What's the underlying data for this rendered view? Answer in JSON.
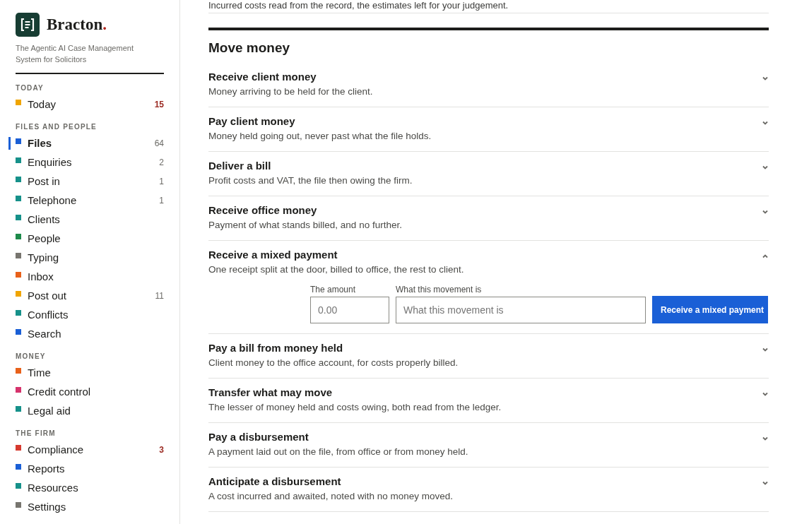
{
  "brand": {
    "name": "Bracton",
    "mark": ".",
    "tagline": "The Agentic AI Case Management System for Solicitors"
  },
  "sidebar": {
    "sections": [
      {
        "heading": "TODAY",
        "items": [
          {
            "label": "Today",
            "color": "#f0a500",
            "count": "15",
            "urgent": true,
            "selected": false
          }
        ]
      },
      {
        "heading": "FILES AND PEOPLE",
        "items": [
          {
            "label": "Files",
            "color": "#1a5fd6",
            "count": "64",
            "urgent": false,
            "selected": true
          },
          {
            "label": "Enquiries",
            "color": "#16918a",
            "count": "2",
            "urgent": false,
            "selected": false
          },
          {
            "label": "Post in",
            "color": "#16918a",
            "count": "1",
            "urgent": false,
            "selected": false
          },
          {
            "label": "Telephone",
            "color": "#16918a",
            "count": "1",
            "urgent": false,
            "selected": false
          },
          {
            "label": "Clients",
            "color": "#16918a",
            "selected": false
          },
          {
            "label": "People",
            "color": "#1d8a4a",
            "selected": false
          },
          {
            "label": "Typing",
            "color": "#77756f",
            "selected": false
          },
          {
            "label": "Inbox",
            "color": "#e8611a",
            "selected": false
          },
          {
            "label": "Post out",
            "color": "#f0a500",
            "count": "11",
            "urgent": false,
            "selected": false
          },
          {
            "label": "Conflicts",
            "color": "#16918a",
            "selected": false
          },
          {
            "label": "Search",
            "color": "#1a5fd6",
            "selected": false
          }
        ]
      },
      {
        "heading": "MONEY",
        "items": [
          {
            "label": "Time",
            "color": "#e8611a",
            "selected": false
          },
          {
            "label": "Credit control",
            "color": "#d6336c",
            "selected": false
          },
          {
            "label": "Legal aid",
            "color": "#16918a",
            "selected": false
          }
        ]
      },
      {
        "heading": "THE FIRM",
        "items": [
          {
            "label": "Compliance",
            "color": "#d63a2f",
            "count": "3",
            "urgent": true,
            "selected": false
          },
          {
            "label": "Reports",
            "color": "#1a5fd6",
            "selected": false
          },
          {
            "label": "Resources",
            "color": "#16918a",
            "selected": false
          },
          {
            "label": "Settings",
            "color": "#77756f",
            "selected": false
          }
        ]
      }
    ]
  },
  "main": {
    "intro": "Incurred costs read from the record, the estimates left for your judgement.",
    "heading": "Move money",
    "actions": [
      {
        "title": "Receive client money",
        "description": "Money arriving to be held for the client.",
        "expanded": false
      },
      {
        "title": "Pay client money",
        "description": "Money held going out, never past what the file holds.",
        "expanded": false
      },
      {
        "title": "Deliver a bill",
        "description": "Profit costs and VAT, the file then owing the firm.",
        "expanded": false
      },
      {
        "title": "Receive office money",
        "description": "Payment of what stands billed, and no further.",
        "expanded": false
      },
      {
        "title": "Receive a mixed payment",
        "description": "One receipt split at the door, billed to office, the rest to client.",
        "expanded": true,
        "form": {
          "amount_label": "The amount",
          "amount_placeholder": "0.00",
          "what_label": "What this movement is",
          "what_placeholder": "What this movement is",
          "submit": "Receive a mixed payment"
        }
      },
      {
        "title": "Pay a bill from money held",
        "description": "Client money to the office account, for costs properly billed.",
        "expanded": false
      },
      {
        "title": "Transfer what may move",
        "description": "The lesser of money held and costs owing, both read from the ledger.",
        "expanded": false
      },
      {
        "title": "Pay a disbursement",
        "description": "A payment laid out on the file, from office or from money held.",
        "expanded": false
      },
      {
        "title": "Anticipate a disbursement",
        "description": "A cost incurred and awaited, noted with no money moved.",
        "expanded": false
      }
    ]
  }
}
